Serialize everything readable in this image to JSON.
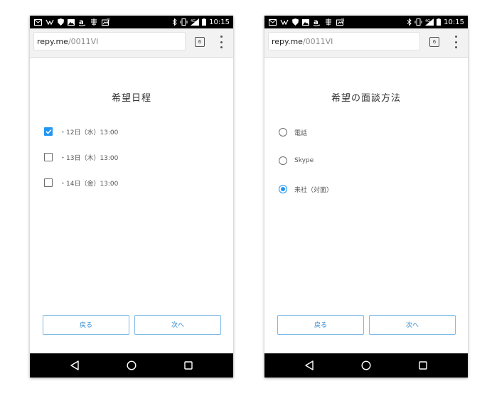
{
  "left_screen": {
    "status_bar": {
      "time": "10:15"
    },
    "browser": {
      "url_host": "repy.me",
      "url_path": "/0011VI",
      "tab_count": "6"
    },
    "title": "希望日程",
    "options": [
      {
        "label": "・12日（水）13:00",
        "checked": true
      },
      {
        "label": "・13日（木）13:00",
        "checked": false
      },
      {
        "label": "・14日（金）13:00",
        "checked": false
      }
    ],
    "buttons": {
      "back": "戻る",
      "next": "次へ"
    }
  },
  "right_screen": {
    "status_bar": {
      "time": "10:15"
    },
    "browser": {
      "url_host": "repy.me",
      "url_path": "/0011VI",
      "tab_count": "6"
    },
    "title": "希望の面談方法",
    "options": [
      {
        "label": "電話",
        "selected": false
      },
      {
        "label": "Skype",
        "selected": false
      },
      {
        "label": "来社（対面）",
        "selected": true
      }
    ],
    "buttons": {
      "back": "戻る",
      "next": "次へ"
    }
  },
  "colors": {
    "accent": "#2196f3",
    "button_text": "#2e86cf",
    "button_border": "#7fb9e6",
    "status_bar": "#000000"
  },
  "icons": {
    "status_left": [
      "mail-icon",
      "voicemail-icon",
      "shield-icon",
      "image-icon",
      "amazon-icon",
      "weather-icon",
      "photo-icon"
    ],
    "status_right": [
      "bluetooth-icon",
      "vibrate-icon",
      "signal-icon",
      "battery-icon"
    ],
    "nav": [
      "back-triangle-icon",
      "home-circle-icon",
      "recents-square-icon"
    ]
  }
}
